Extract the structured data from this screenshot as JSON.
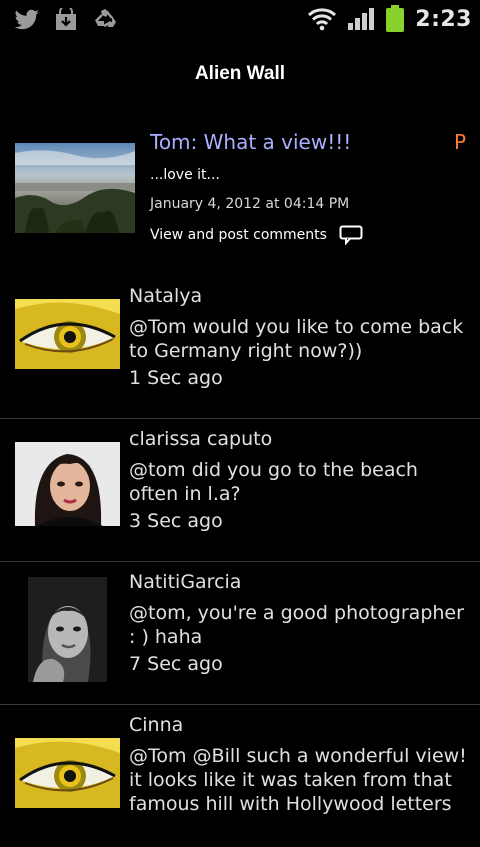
{
  "status_bar": {
    "time": "2:23",
    "icons": [
      "twitter-icon",
      "download-icon",
      "recycle-icon",
      "wifi-icon",
      "signal-icon",
      "battery-icon"
    ]
  },
  "header": {
    "title": "Alien Wall"
  },
  "post": {
    "title": "Tom: What a view!!!",
    "badge": "P",
    "body": "...love it...",
    "date": "January 4, 2012 at 04:14 PM",
    "comments_link": "View and post comments"
  },
  "comments": [
    {
      "name": "Natalya",
      "text": "@Tom would you like to come back to Germany right now?))",
      "time": "1 Sec ago",
      "avatar": "yellow-eye"
    },
    {
      "name": "clarissa caputo",
      "text": "@tom did you go to the beach often in l.a?",
      "time": "3 Sec ago",
      "avatar": "portrait-dark-hair"
    },
    {
      "name": "NatitiGarcia",
      "text": "@tom, you're a good photographer : ) haha",
      "time": "7 Sec ago",
      "avatar": "portrait-grayscale"
    },
    {
      "name": "Cinna",
      "text": "@Tom @Bill such a wonderful view! it looks like it was taken from that famous hill with Hollywood letters",
      "time": "",
      "avatar": "yellow-eye"
    }
  ],
  "colors": {
    "background": "#000000",
    "post_title": "#aab0ff",
    "badge": "#ff7a3c",
    "divider": "#3a3a3a",
    "battery": "#8bd12c"
  }
}
